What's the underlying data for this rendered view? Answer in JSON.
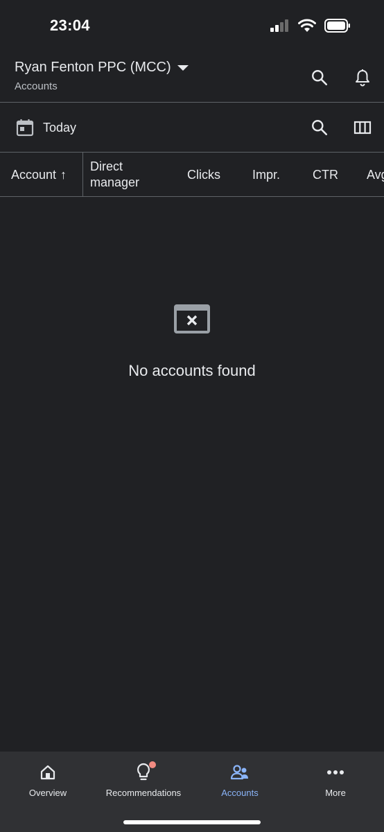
{
  "status": {
    "time": "23:04"
  },
  "header": {
    "title": "Ryan Fenton PPC (MCC)",
    "subtitle": "Accounts"
  },
  "datebar": {
    "label": "Today"
  },
  "table": {
    "columns": [
      "Account",
      "Direct manager",
      "Clicks",
      "Impr.",
      "CTR",
      "Avg"
    ],
    "sort_indicator": "↑"
  },
  "empty_state": {
    "message": "No accounts found"
  },
  "bottom_nav": {
    "items": [
      {
        "label": "Overview",
        "icon": "home-icon"
      },
      {
        "label": "Recommendations",
        "icon": "lightbulb-icon"
      },
      {
        "label": "Accounts",
        "icon": "accounts-icon",
        "active": true
      },
      {
        "label": "More",
        "icon": "more-icon"
      }
    ]
  },
  "colors": {
    "background": "#202124",
    "nav_background": "#303134",
    "accent": "#8ab4f8",
    "badge": "#f28b82",
    "divider": "#5f6368"
  }
}
